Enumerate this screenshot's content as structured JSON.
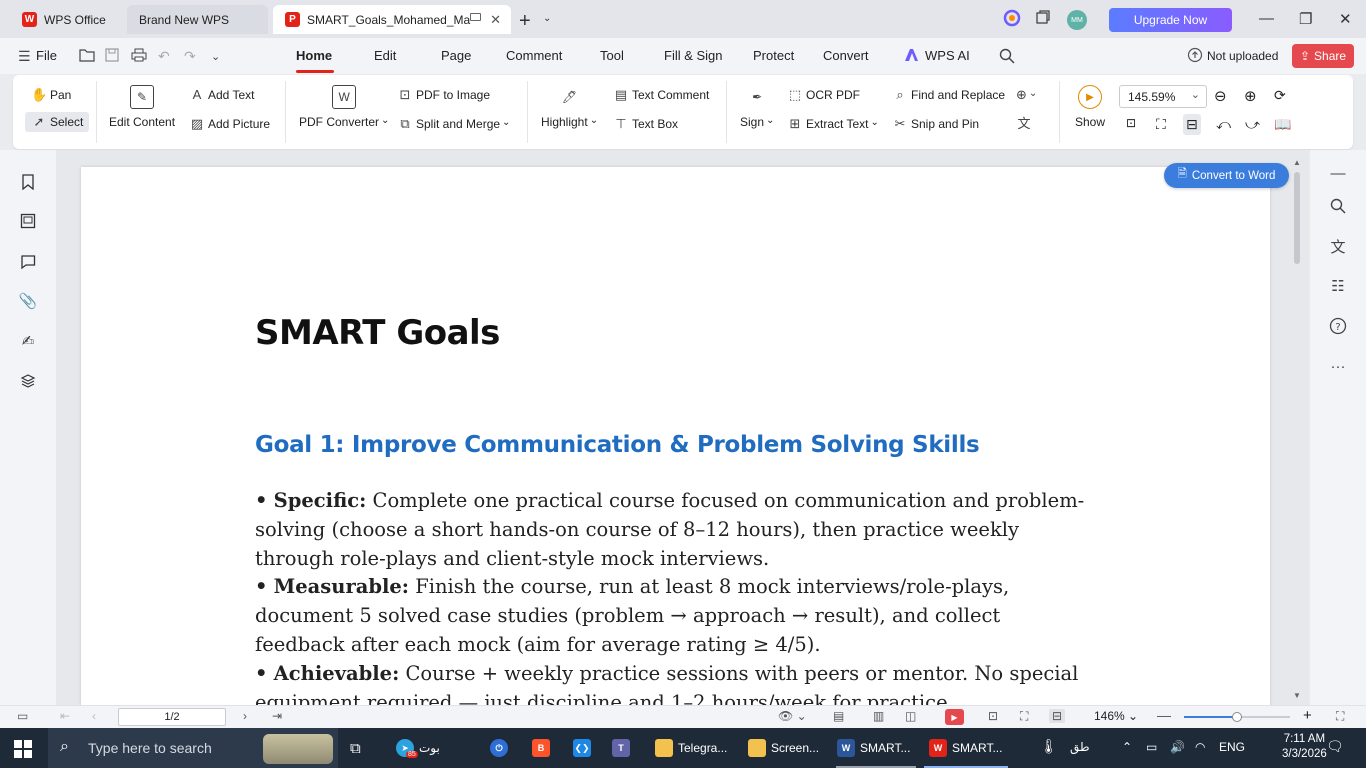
{
  "tabs": {
    "home_tab": "WPS Office",
    "brand_tab": "Brand New WPS",
    "doc_tab": "SMART_Goals_Mohamed_Ma"
  },
  "titlebar": {
    "upgrade": "Upgrade Now",
    "avatar_initials": "MM"
  },
  "menubar": {
    "file": "File",
    "home": "Home",
    "edit": "Edit",
    "page": "Page",
    "comment": "Comment",
    "tool": "Tool",
    "fill_sign": "Fill & Sign",
    "protect": "Protect",
    "convert": "Convert",
    "wps_ai": "WPS AI",
    "not_uploaded": "Not uploaded",
    "share": "Share"
  },
  "ribbon": {
    "pan": "Pan",
    "select": "Select",
    "edit_content": "Edit Content",
    "add_text": "Add Text",
    "add_picture": "Add Picture",
    "pdf_converter": "PDF Converter",
    "pdf_to_image": "PDF to Image",
    "split_merge": "Split and Merge",
    "highlight": "Highlight",
    "text_comment": "Text Comment",
    "text_box": "Text Box",
    "sign": "Sign",
    "ocr_pdf": "OCR PDF",
    "extract_text": "Extract Text",
    "find_replace": "Find and Replace",
    "snip_pin": "Snip and Pin",
    "show": "Show",
    "zoom_value": "145.59%"
  },
  "document": {
    "title": "SMART Goals",
    "goal_heading": "Goal 1: Improve Communication & Problem Solving Skills",
    "specific_label": "Specific:",
    "specific_text": " Complete one practical course focused on communication and problem-solving (choose a short hands-on course of 8–12 hours), then practice weekly through role-plays and client-style mock interviews.",
    "measurable_label": "Measurable:",
    "measurable_text": " Finish the course, run at least 8 mock interviews/role-plays, document 5 solved case studies (problem → approach → result), and collect feedback after each mock (aim for average rating ≥ 4/5).",
    "achievable_label": "Achievable:",
    "achievable_text": " Course + weekly practice sessions with peers or mentor. No special equipment required — just discipline and 1–2 hours/week for practice.",
    "bullet": "•",
    "convert_to_word": "Convert to Word"
  },
  "statusbar": {
    "page_indicator": "1/2",
    "zoom_percent": "146%",
    "zoom_fraction": 0.5
  },
  "taskbar": {
    "search_placeholder": "Type here to search",
    "telegram_label": "Telegra...",
    "screen_label": "Screen...",
    "word_label": "SMART...",
    "wps_label": "SMART...",
    "rtl_label": "بوت",
    "weather_label": "طق",
    "lang": "ENG",
    "time": "7:11 AM",
    "date": "3/3/2026",
    "telegram_badge": "85"
  }
}
